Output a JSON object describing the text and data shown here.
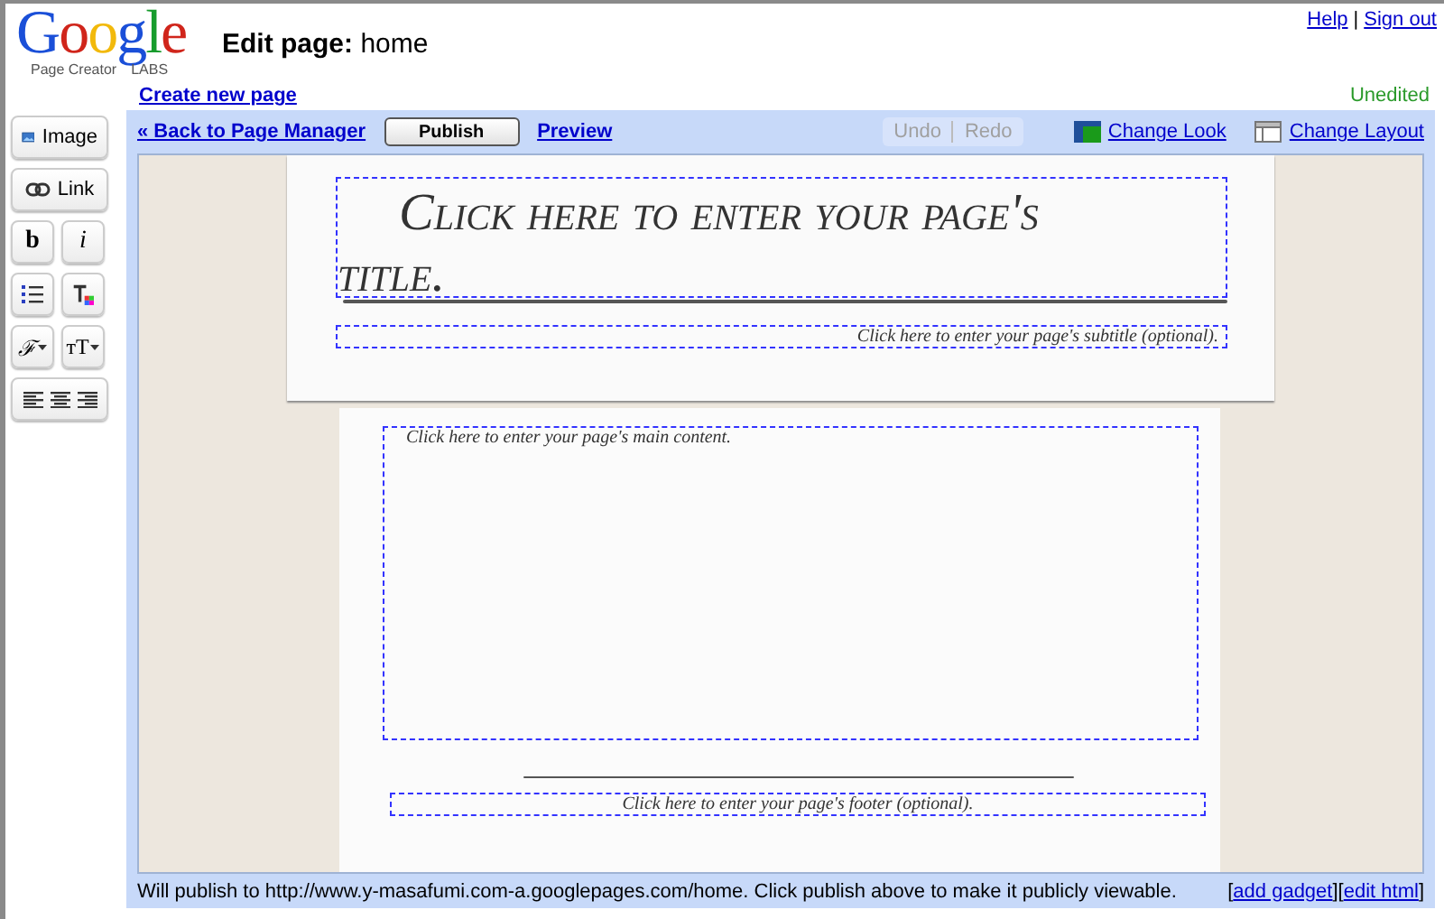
{
  "logo": {
    "wordmark": "Google",
    "tagline": "Page Creator",
    "badge": "LABS"
  },
  "page_heading": {
    "label": "Edit page:",
    "name": "home"
  },
  "top_links": [
    "Help",
    "Sign out"
  ],
  "top_links_separator": "|",
  "create_link": "Create new page",
  "status": "Unedited",
  "tools": [
    {
      "items": [
        {
          "kind": "image",
          "label": "Image"
        }
      ]
    },
    {
      "items": [
        {
          "kind": "link",
          "label": "Link"
        }
      ]
    },
    {
      "items": [
        {
          "kind": "bold",
          "label": "b"
        },
        {
          "kind": "italic",
          "label": "i"
        }
      ]
    },
    {
      "items": [
        {
          "kind": "list"
        },
        {
          "kind": "text-color"
        }
      ]
    },
    {
      "items": [
        {
          "kind": "font",
          "label": "ℱ"
        },
        {
          "kind": "text-size",
          "label": "ᴛT"
        }
      ]
    },
    {
      "items": [
        {
          "kind": "align"
        }
      ]
    }
  ],
  "toolbar": {
    "back": "« Back to Page Manager",
    "publish": "Publish",
    "preview": "Preview",
    "history": [
      {
        "label": "Undo",
        "disabled": true
      },
      {
        "label": "Redo",
        "disabled": true
      }
    ],
    "change_look": "Change Look",
    "change_layout": "Change Layout"
  },
  "editor": {
    "title": "Click here to enter your page's title.",
    "subtitle": "Click here to enter your page's subtitle (optional).",
    "content": "Click here to enter your page's main content.",
    "footer": "Click here to enter your page's footer (optional)."
  },
  "status_bar": {
    "message": "Will publish to http://www.y-masafumi.com-a.googlepages.com/home. Click publish above to make it publicly viewable.",
    "links": [
      "add gadget",
      "edit html"
    ],
    "open_bracket": "[",
    "close_bracket": "]"
  }
}
